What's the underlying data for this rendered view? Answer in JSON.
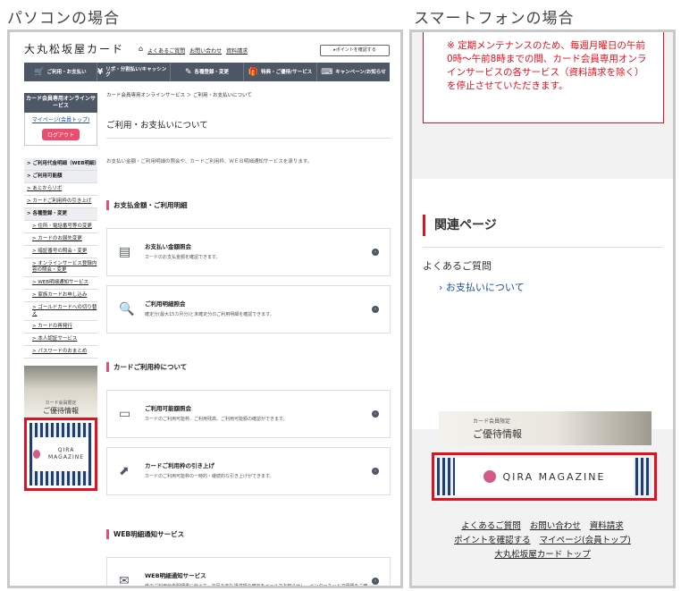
{
  "labels": {
    "pc": "パソコンの場合",
    "sp": "スマートフォンの場合"
  },
  "pc": {
    "logo": "大丸松坂屋カード",
    "toplinks": [
      "よくあるご質問",
      "お問い合わせ",
      "資料請求"
    ],
    "point_button": "▸ポイントを確認する",
    "nav": [
      {
        "icon": "🛒",
        "label": "ご利用・お支払い"
      },
      {
        "icon": "¥",
        "label": "リボ・分割払い/キャッシング"
      },
      {
        "icon": "✎",
        "label": "各種登録・変更"
      },
      {
        "icon": "🎁",
        "label": "特典・ご優待/サービス"
      },
      {
        "icon": "⌨",
        "label": "キャンペーン/お知らせ"
      }
    ],
    "sidebar": {
      "title": "カード会員専用オンラインサービス",
      "mypage": "マイページ(会員トップ)",
      "logout": "ログアウト",
      "menu": [
        {
          "label": "> ご利用代金明細（WEB明細）",
          "type": "parent"
        },
        {
          "label": "> ご利用可能額",
          "type": "parent"
        },
        {
          "label": "> あとからリボ",
          "type": "normal"
        },
        {
          "label": "> カードご利用枠の引き上げ",
          "type": "normal"
        },
        {
          "label": "> 各種登録・変更",
          "type": "parent"
        },
        {
          "label": "> 住所・電話番号等の変更",
          "type": "sub"
        },
        {
          "label": "> カードのお届先変更",
          "type": "sub"
        },
        {
          "label": "> 暗証番号の照会・変更",
          "type": "sub"
        },
        {
          "label": "> オンラインサービス登録内容の照会・変更",
          "type": "sub"
        },
        {
          "label": "> WEB明細通知サービス",
          "type": "sub"
        },
        {
          "label": "> 家族カードお申し込み",
          "type": "sub"
        },
        {
          "label": "> ゴールドカードへの切り替え",
          "type": "sub"
        },
        {
          "label": "> カードの再発行",
          "type": "sub"
        },
        {
          "label": "> 本人認証サービス",
          "type": "sub"
        },
        {
          "label": "> パスワードのおまとめ",
          "type": "sub"
        }
      ],
      "yutai_small": "カード会員限定",
      "yutai_big": "ご優待情報",
      "qira": "QIRA MAGAZINE"
    },
    "main": {
      "breadcrumb": "カード会員専用オンラインサービス ＞ ご利用・お支払いについて",
      "title": "ご利用・お支払いについて",
      "desc": "お支払い金額・ご利用明細の照会や、カードご利用枠、ＷＥＢ明細通知サービスを承ります。",
      "sections": [
        {
          "heading": "お支払金額・ご利用明細",
          "cards": [
            {
              "icon": "▤",
              "title": "お支払い金額照会",
              "desc": "カードのお支払金額を確認できます。"
            },
            {
              "icon": "🔍",
              "title": "ご利用明細照会",
              "desc": "確定分(最大15カ月分)と未確定分のご利用明細を確認できます。"
            }
          ]
        },
        {
          "heading": "カードご利用枠について",
          "cards": [
            {
              "icon": "▭",
              "title": "ご利用可能額照会",
              "desc": "カードのご利用可能枠、ご利用残高、ご利用可能額の確認ができます。"
            },
            {
              "icon": "⬈",
              "title": "カードご利用枠の引き上げ",
              "desc": "カードのご利用可能枠の一時的・継続的な引き上げができます。"
            }
          ]
        },
        {
          "heading": "WEB明細通知サービス",
          "cards": [
            {
              "icon": "✉",
              "title": "WEB明細通知サービス",
              "desc": "紙のご利用代金明細書に代えて、次回お支払請求額の確定をメールでお知らせし、インターネットで明細をご確認いただくサービスです。"
            }
          ]
        }
      ]
    }
  },
  "sp": {
    "notice": "※ 定期メンテナンスのため、毎週月曜日の午前0時～午前8時までの間、カード会員専用オンラインサービスの各サービス（資料請求を除く）を停止させていただきます。",
    "related_title": "関連ページ",
    "faq": "よくあるご質問",
    "faq_link": "› お支払いについて",
    "yutai_small": "カード会員限定",
    "yutai_big": "ご優待情報",
    "qira": "QIRA MAGAZINE",
    "footer_links": [
      [
        "よくあるご質問",
        "お問い合わせ",
        "資料請求"
      ],
      [
        "ポイントを確認する",
        "マイページ(会員トップ)"
      ],
      [
        "大丸松坂屋カード トップ"
      ]
    ]
  }
}
